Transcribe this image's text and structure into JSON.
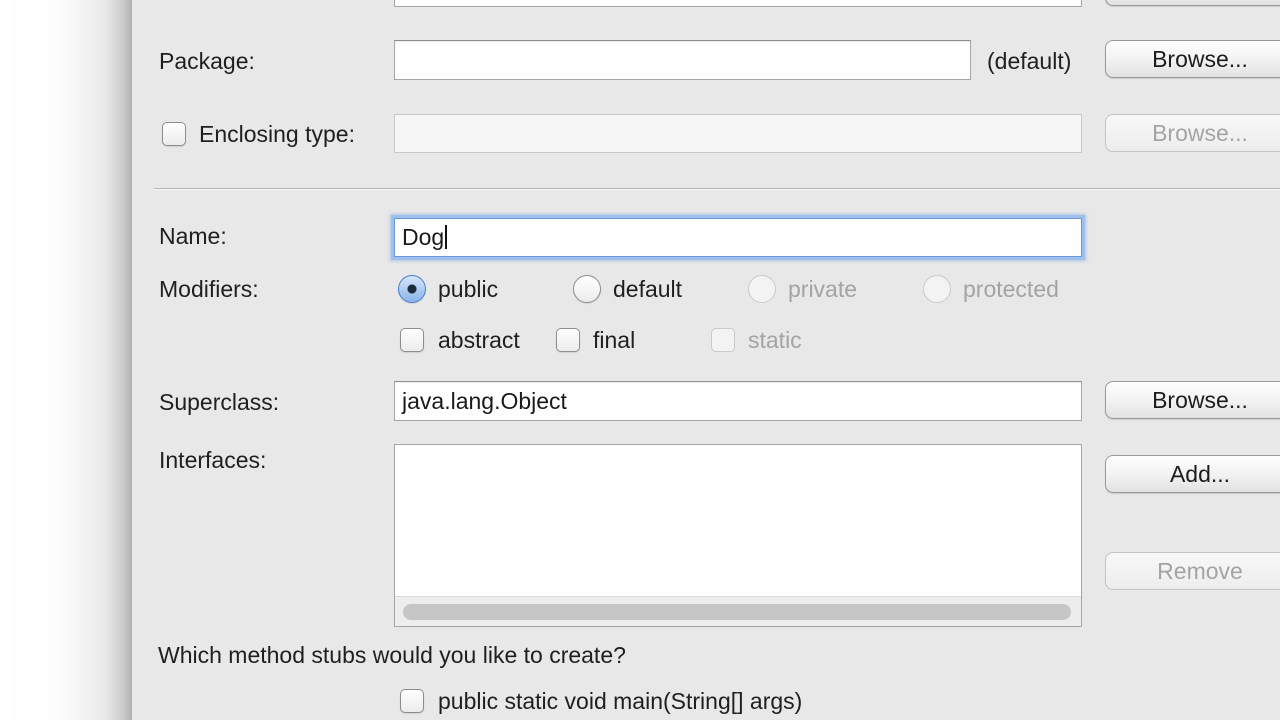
{
  "package": {
    "label": "Package:",
    "value": "",
    "hint": "(default)",
    "browse_label": "Browse..."
  },
  "enclosing_type": {
    "label": "Enclosing type:",
    "checked": false,
    "value": "",
    "browse_label": "Browse..."
  },
  "name": {
    "label": "Name:",
    "value": "Dog"
  },
  "modifiers": {
    "label": "Modifiers:",
    "selected": "public",
    "radios": [
      {
        "label": "public",
        "selected": true,
        "enabled": true
      },
      {
        "label": "default",
        "selected": false,
        "enabled": true
      },
      {
        "label": "private",
        "selected": false,
        "enabled": false
      },
      {
        "label": "protected",
        "selected": false,
        "enabled": false
      }
    ],
    "checkboxes": [
      {
        "label": "abstract",
        "checked": false,
        "enabled": true
      },
      {
        "label": "final",
        "checked": false,
        "enabled": true
      },
      {
        "label": "static",
        "checked": false,
        "enabled": false
      }
    ]
  },
  "superclass": {
    "label": "Superclass:",
    "value": "java.lang.Object",
    "browse_label": "Browse..."
  },
  "interfaces": {
    "label": "Interfaces:",
    "items": [],
    "add_label": "Add...",
    "remove_label": "Remove"
  },
  "method_stubs": {
    "question": "Which method stubs would you like to create?",
    "options": [
      {
        "label": "public static void main(String[] args)",
        "checked": false
      }
    ]
  },
  "colors": {
    "dialog_background": "#e8e8e8",
    "focus_ring": "#9fc0ec",
    "disabled_text": "#a3a3a3"
  }
}
